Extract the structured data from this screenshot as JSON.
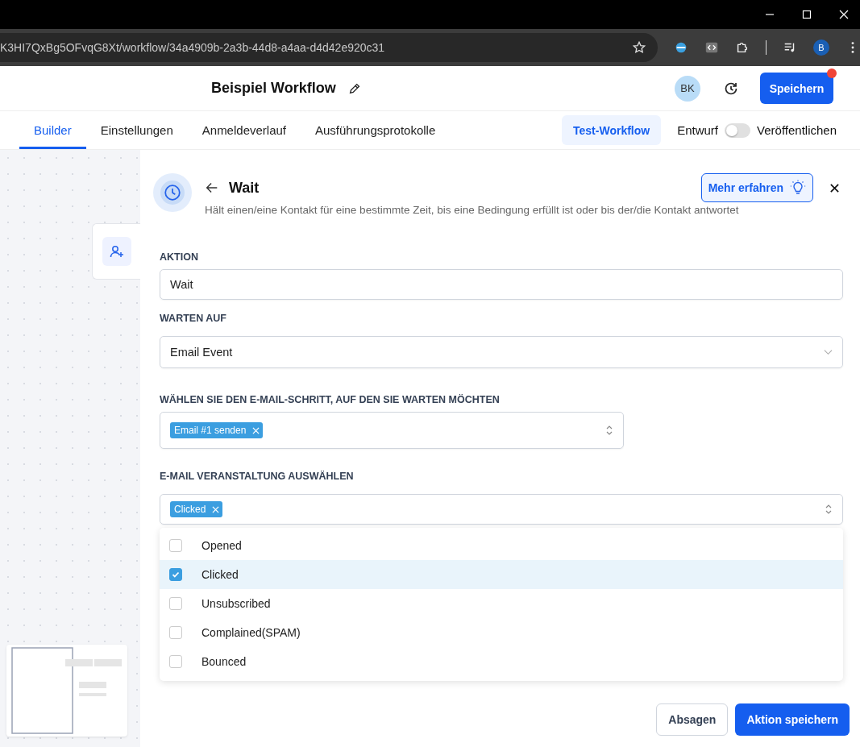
{
  "browser": {
    "url": "K3HI7QxBg5OFvqG8Xt/workflow/34a4909b-2a3b-44d8-a4aa-d4d42e920c31",
    "profile": "B"
  },
  "header": {
    "title": "Beispiel Workflow",
    "avatar": "BK",
    "save": "Speichern",
    "save_badge": true
  },
  "tabs": [
    {
      "label": "Builder",
      "selected": true
    },
    {
      "label": "Einstellungen",
      "selected": false
    },
    {
      "label": "Anmeldeverlauf",
      "selected": false
    },
    {
      "label": "Ausführungsprotokolle",
      "selected": false
    }
  ],
  "test_button": "Test-Workflow",
  "publish": {
    "draft_label": "Entwurf",
    "on": false,
    "publish_label": "Veröffentlichen"
  },
  "panel": {
    "title": "Wait",
    "description": "Hält einen/eine Kontakt für eine bestimmte Zeit, bis eine Bedingung erfüllt ist oder bis der/die Kontakt antwortet",
    "learn_more": "Mehr erfahren",
    "action_label": "AKTION",
    "action_value": "Wait",
    "wait_label": "WARTEN AUF",
    "wait_value": "Email Event",
    "step_label": "WÄHLEN SIE DEN E-MAIL-SCHRITT, AUF DEN SIE WARTEN MÖCHTEN",
    "step_tags": [
      "Email #1 senden"
    ],
    "event_label": "E-MAIL VERANSTALTUNG AUSWÄHLEN",
    "event_tags": [
      "Clicked"
    ],
    "options": [
      {
        "label": "Opened",
        "checked": false,
        "highlighted": false
      },
      {
        "label": "Clicked",
        "checked": true,
        "highlighted": true
      },
      {
        "label": "Unsubscribed",
        "checked": false,
        "highlighted": false
      },
      {
        "label": "Complained(SPAM)",
        "checked": false,
        "highlighted": false
      },
      {
        "label": "Bounced",
        "checked": false,
        "highlighted": false
      }
    ],
    "cancel": "Absagen",
    "submit": "Aktion speichern"
  }
}
